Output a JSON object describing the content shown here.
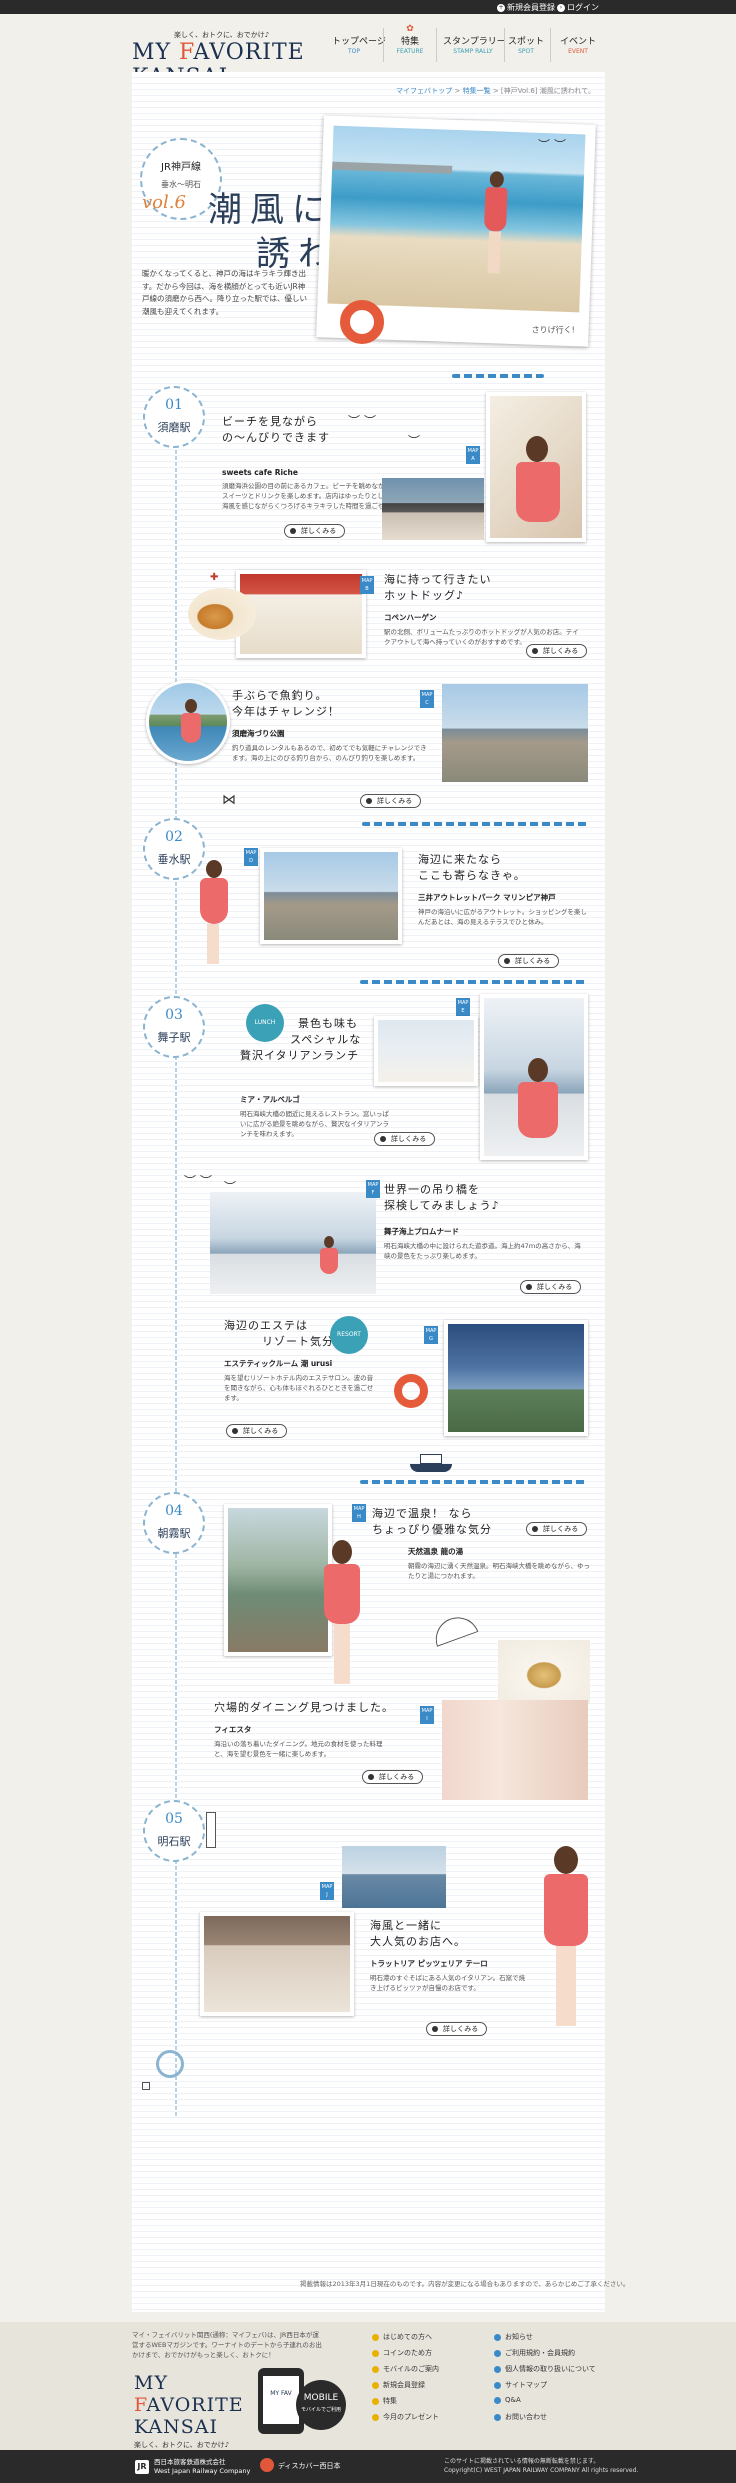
{
  "topbar": {
    "register": "新規会員登録",
    "login": "ログイン"
  },
  "header": {
    "logo": {
      "tagline": "楽しく、おトクに、おでかけ♪",
      "text_pre": "MY ",
      "text_accent": "F",
      "text_post": "AVORITE KANSAI"
    },
    "nav": [
      {
        "jp": "トップページ",
        "en": "TOP"
      },
      {
        "jp": "特集",
        "en": "FEATURE"
      },
      {
        "jp": "スタンプラリー",
        "en": "STAMP RALLY"
      },
      {
        "jp": "スポット",
        "en": "SPOT"
      },
      {
        "jp": "イベント",
        "en": "EVENT"
      }
    ]
  },
  "breadcrumb": {
    "items": [
      "マイフェバトップ",
      "特集一覧"
    ],
    "current": "[神戸Vol.6] 潮風に誘われて。"
  },
  "hero": {
    "line": "JR神戸線",
    "area": "垂水～明石",
    "vol": "vol.6",
    "title1": "潮風に",
    "title2": "誘われて。",
    "lead": "暖かくなってくると、神戸の海はキラキラ輝き出す。だから今回は、海を横顔がとっても近いJR神戸線の須磨から西へ。降り立った駅では、優しい潮風も迎えてくれます。",
    "caption": "さりげ行く!"
  },
  "stations": [
    {
      "num": "01",
      "name": "須磨駅"
    },
    {
      "num": "02",
      "name": "垂水駅"
    },
    {
      "num": "03",
      "name": "舞子駅"
    },
    {
      "num": "04",
      "name": "朝霧駅"
    },
    {
      "num": "05",
      "name": "明石駅"
    }
  ],
  "spots": {
    "a": {
      "map": "A",
      "hl1": "ビーチを見ながら",
      "hl2": "の～んびりできます",
      "name": "sweets cafe Riche",
      "desc": "須磨海浜公園の目の前にあるカフェ。ビーチを眺めながらのんびりスイーツとドリンクを楽しめます。店内はゆったりとした空間で、海風を感じながらくつろげるキラキラした時間を過ごせます。"
    },
    "b": {
      "map": "B",
      "hl1": "海に持って行きたい",
      "hl2": "ホットドッグ♪",
      "name": "コペンハーゲン",
      "desc": "駅の北側、ボリュームたっぷりのホットドッグが人気のお店。テイクアウトして海へ持っていくのがおすすめです。"
    },
    "c": {
      "map": "C",
      "hl1": "手ぶらで魚釣り。",
      "hl2": "今年はチャレンジ！",
      "name": "須磨海づり公園",
      "desc": "釣り道具のレンタルもあるので、初めてでも気軽にチャレンジできます。海の上にのびる釣り台から、のんびり釣りを楽しめます。"
    },
    "d": {
      "map": "D",
      "hl1": "海辺に来たなら",
      "hl2": "ここも寄らなきゃ。",
      "name": "三井アウトレットパーク マリンピア神戸",
      "desc": "神戸の海沿いに広がるアウトレット。ショッピングを楽しんだあとは、海の見えるテラスでひと休み。"
    },
    "e": {
      "map": "E",
      "hl1": "景色も味も",
      "hl2": "スペシャルな",
      "hl3": "贅沢イタリアンランチ",
      "name": "ミア・アルベルゴ",
      "desc": "明石海峡大橋の間近に見えるレストラン。窓いっぱいに広がる絶景を眺めながら、贅沢なイタリアンランチを味わえます。"
    },
    "f": {
      "map": "F",
      "hl1": "世界一の吊り橋を",
      "hl2": "探検してみましょう♪",
      "name": "舞子海上プロムナード",
      "desc": "明石海峡大橋の中に設けられた遊歩道。海上約47ｍの高さから、海峡の景色をたっぷり楽しめます。"
    },
    "g": {
      "map": "G",
      "hl1": "海辺のエステは",
      "hl2": "リゾート気分です",
      "name": "エステティックルーム 潮 urusi",
      "desc": "海を望むリゾートホテル内のエステサロン。波の音を聞きながら、心も体もほぐれるひとときを過ごせます。"
    },
    "h": {
      "map": "H",
      "hl1": "海辺で温泉！ なら",
      "hl2": "ちょっぴり優雅な気分",
      "name": "天然温泉 龍の湯",
      "desc": "朝霧の海辺に湧く天然温泉。明石海峡大橋を眺めながら、ゆったりと湯につかれます。"
    },
    "i": {
      "map": "I",
      "hl1": "穴場的ダイニング見つけました。",
      "name": "フィエスタ",
      "desc": "海沿いの落ち着いたダイニング。地元の食材を使った料理と、海を望む景色を一緒に楽しめます。"
    },
    "j": {
      "map": "J",
      "hl1": "海風と一緒に",
      "hl2": "大人気のお店へ。",
      "name": "トラットリア ピッツェリア テーロ",
      "desc": "明石港のすぐそばにある人気のイタリアン。石窯で焼き上げるピッツァが自慢のお店です。"
    }
  },
  "detail_label": "詳しくみる",
  "lower_note": "掲載情報は2013年3月1日現在のものです。内容が変更になる場合もありますので、あらかじめご了承ください。",
  "footer": {
    "desc": "マイ・フェイバリット関西(通称：マイフェバ)は、JR西日本が運営するWEBマガジンです。ワーナイトのデートから子連れのお出かけまで、おでかけがもっと楽しく、おトクに！",
    "logo_pre": "MY ",
    "logo_accent": "F",
    "logo_post": "AVORITE",
    "logo_line2": "KANSAI",
    "tagline": "楽しく、おトクに、おでかけ♪",
    "mobile_title": "MY FAV",
    "mobile_badge": "MOBILE",
    "mobile_sub": "モバイルでご利用",
    "links_col1": [
      "はじめての方へ",
      "コインのため方",
      "モバイルのご案内",
      "新規会員登録",
      "特集",
      "今月のプレゼント"
    ],
    "links_col2": [
      "お知らせ",
      "ご利用規約・会員規約",
      "個人情報の取り扱いについて",
      "サイトマップ",
      "Q&A",
      "お問い合わせ"
    ],
    "jr_mark": "JR",
    "jr_name1": "西日本旅客鉄道株式会社",
    "jr_name2": "West Japan Railway Company",
    "disc_text": "ディスカバー西日本",
    "copyright1": "このサイトに掲載されている情報の無断転載を禁じます。",
    "copyright2": "Copyright(C) WEST JAPAN RAILWAY COMPANY All rights reserved."
  }
}
